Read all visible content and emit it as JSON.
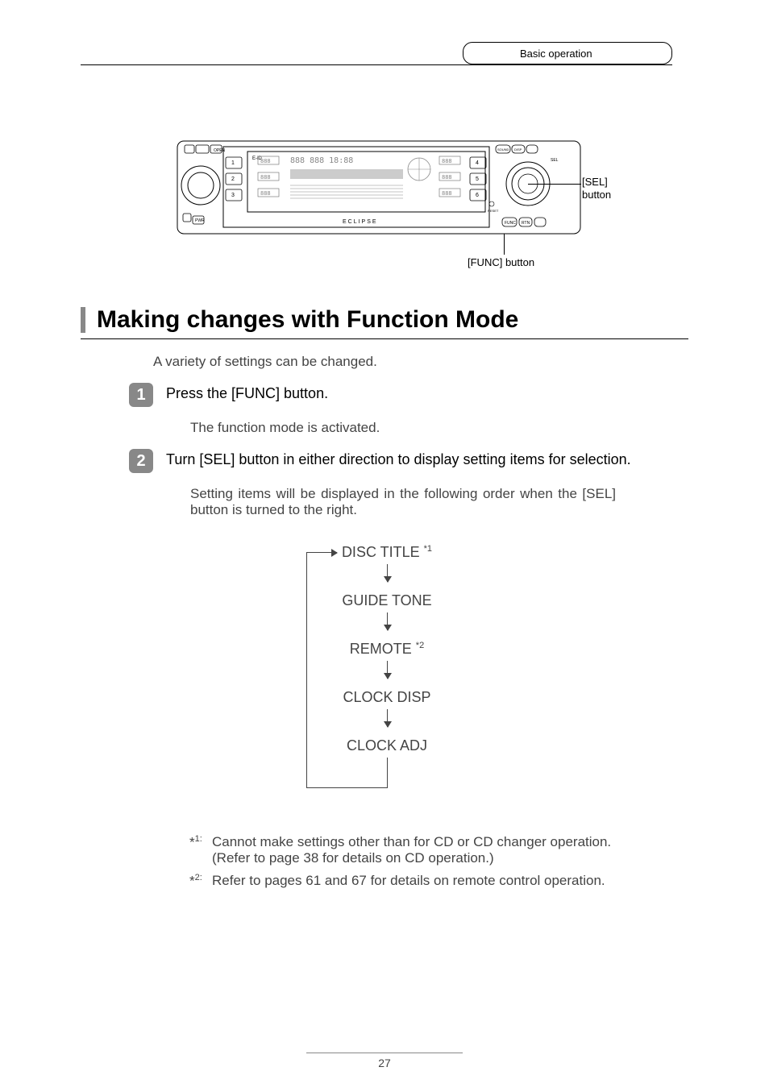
{
  "header": {
    "section_name": "Basic operation"
  },
  "callouts": {
    "sel": "[SEL] button",
    "func": "[FUNC] button"
  },
  "heading": "Making changes with Function Mode",
  "intro": "A variety of settings can be changed.",
  "steps": [
    {
      "num": "1",
      "title": "Press the [FUNC] button.",
      "desc": "The function mode is activated."
    },
    {
      "num": "2",
      "title": "Turn [SEL] button in either direction to display setting items for selection.",
      "desc": "Setting items will be displayed in the following order when the [SEL] button is turned to the right."
    }
  ],
  "flow": {
    "items": [
      {
        "label": "DISC TITLE ",
        "sup": "*1"
      },
      {
        "label": "GUIDE TONE",
        "sup": ""
      },
      {
        "label": "REMOTE ",
        "sup": "*2"
      },
      {
        "label": "CLOCK DISP",
        "sup": ""
      },
      {
        "label": "CLOCK ADJ",
        "sup": ""
      }
    ]
  },
  "footnotes": [
    {
      "marker": "*",
      "sup": "1:",
      "text": "Cannot make settings other than for CD or CD changer operation.",
      "text2": "(Refer to page 38 for details on CD operation.)"
    },
    {
      "marker": "*",
      "sup": "2:",
      "text": "Refer to pages 61 and 67 for details on remote control operation."
    }
  ],
  "page_number": "27"
}
